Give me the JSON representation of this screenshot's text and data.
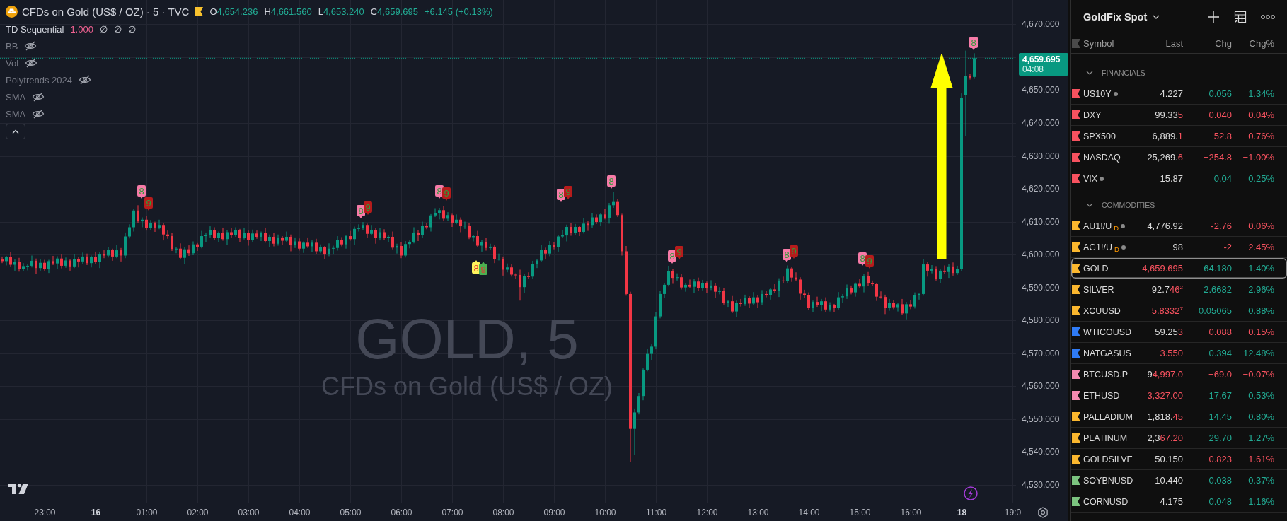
{
  "chart": {
    "header": {
      "title": "CFDs on Gold (US$ / OZ) · 5 · TVC",
      "ohlc": [
        {
          "label": "O",
          "value": "4,654.236"
        },
        {
          "label": "H",
          "value": "4,661.560"
        },
        {
          "label": "L",
          "value": "4,653.240"
        },
        {
          "label": "C",
          "value": "4,659.695"
        }
      ],
      "change": "+6.145 (+0.13%)",
      "negative": false
    },
    "indicators": [
      {
        "name": "TD Sequential",
        "hidden": false,
        "values": [
          {
            "text": "1.000",
            "color": "#f06292"
          },
          {
            "text": "∅"
          },
          {
            "text": "∅"
          },
          {
            "text": "∅"
          }
        ]
      },
      {
        "name": "BB",
        "hidden": true
      },
      {
        "name": "Vol",
        "hidden": true
      },
      {
        "name": "Polytrends 2024",
        "hidden": true
      },
      {
        "name": "SMA",
        "hidden": true
      },
      {
        "name": "SMA",
        "hidden": true
      }
    ],
    "watermark": {
      "symbol": "GOLD, 5",
      "description": "CFDs on Gold (US$ / OZ)"
    },
    "chart_data": {
      "type": "candlestick",
      "grid": true,
      "ylim": [
        4524.37,
        4677.39
      ],
      "categories": [
        null,
        null,
        null,
        null,
        null,
        null,
        null,
        null,
        null,
        null,
        "23:00",
        null,
        null,
        null,
        null,
        null,
        null,
        null,
        null,
        null,
        null,
        null,
        "16",
        null,
        null,
        null,
        null,
        null,
        null,
        null,
        null,
        null,
        null,
        null,
        "01:00",
        null,
        null,
        null,
        null,
        null,
        null,
        null,
        null,
        null,
        null,
        null,
        "02:00",
        null,
        null,
        null,
        null,
        null,
        null,
        null,
        null,
        null,
        null,
        null,
        "03:00",
        null,
        null,
        null,
        null,
        null,
        null,
        null,
        null,
        null,
        null,
        null,
        "04:00",
        null,
        null,
        null,
        null,
        null,
        null,
        null,
        null,
        null,
        null,
        null,
        "05:00",
        null,
        null,
        null,
        null,
        null,
        null,
        null,
        null,
        null,
        null,
        null,
        "06:00",
        null,
        null,
        null,
        null,
        null,
        null,
        null,
        null,
        null,
        null,
        null,
        "07:00",
        null,
        null,
        null,
        null,
        null,
        null,
        null,
        null,
        null,
        null,
        null,
        "08:00",
        null,
        null,
        null,
        null,
        null,
        null,
        null,
        null,
        null,
        null,
        null,
        "09:00",
        null,
        null,
        null,
        null,
        null,
        null,
        null,
        null,
        null,
        null,
        null,
        "10:00",
        null,
        null,
        null,
        null,
        null,
        null,
        null,
        null,
        null,
        null,
        null,
        "11:00",
        null,
        null,
        null,
        null,
        null,
        null,
        null,
        null,
        null,
        null,
        null,
        "12:00",
        null,
        null,
        null,
        null,
        null,
        null,
        null,
        null,
        null,
        null,
        null,
        "13:00",
        null,
        null,
        null,
        null,
        null,
        null,
        null,
        null,
        null,
        null,
        null,
        "14:00",
        null,
        null,
        null,
        null,
        null,
        null,
        null,
        null,
        null,
        null,
        null,
        "15:00",
        null,
        null,
        null,
        null,
        null,
        null,
        null,
        null,
        null,
        null,
        null,
        "16:00",
        null,
        null,
        null,
        null,
        null,
        null,
        null,
        null,
        null,
        null,
        null,
        "18",
        null,
        null,
        null,
        null,
        null,
        null,
        null,
        null,
        null,
        null,
        null,
        "19:0"
      ],
      "ohlc": [
        [
          4598.5,
          4599.4,
          4597.4,
          4598.0
        ],
        [
          4598.0,
          4599.6,
          4596.7,
          4599.2
        ],
        [
          4599.2,
          4600.8,
          4596.4,
          4596.9
        ],
        [
          4596.9,
          4598.5,
          4595.1,
          4597.8
        ],
        [
          4597.8,
          4599.0,
          4594.8,
          4595.6
        ],
        [
          4595.6,
          4597.4,
          4595.0,
          4596.5
        ],
        [
          4596.5,
          4597.0,
          4595.2,
          4596.6
        ],
        [
          4596.6,
          4599.7,
          4596.1,
          4598.1
        ],
        [
          4598.1,
          4598.8,
          4594.1,
          4595.9
        ],
        [
          4595.9,
          4598.7,
          4595.1,
          4597.5
        ],
        [
          4597.5,
          4598.4,
          4595.1,
          4595.7
        ],
        [
          4595.7,
          4598.4,
          4594.4,
          4598.0
        ],
        [
          4598.0,
          4599.6,
          4596.8,
          4597.3
        ],
        [
          4597.3,
          4599.5,
          4595.5,
          4598.8
        ],
        [
          4598.8,
          4600.0,
          4595.8,
          4596.6
        ],
        [
          4596.6,
          4599.1,
          4596.0,
          4598.2
        ],
        [
          4598.2,
          4598.6,
          4595.1,
          4596.4
        ],
        [
          4596.4,
          4600.2,
          4595.9,
          4598.6
        ],
        [
          4598.6,
          4599.3,
          4596.1,
          4597.9
        ],
        [
          4597.9,
          4600.6,
          4597.1,
          4599.4
        ],
        [
          4599.4,
          4600.3,
          4596.8,
          4597.4
        ],
        [
          4597.4,
          4599.7,
          4596.1,
          4599.3
        ],
        [
          4599.3,
          4600.9,
          4597.2,
          4597.7
        ],
        [
          4597.7,
          4600.8,
          4595.9,
          4600.1
        ],
        [
          4600.1,
          4601.3,
          4598.9,
          4599.7
        ],
        [
          4599.7,
          4602.3,
          4599.1,
          4601.4
        ],
        [
          4601.4,
          4601.8,
          4598.1,
          4599.4
        ],
        [
          4599.4,
          4602.9,
          4598.9,
          4601.3
        ],
        [
          4601.3,
          4602.0,
          4597.9,
          4599.7
        ],
        [
          4599.7,
          4606.7,
          4598.9,
          4605.5
        ],
        [
          4605.5,
          4609.2,
          4604.9,
          4608.3
        ],
        [
          4608.3,
          4613.8,
          4607.0,
          4613.4
        ],
        [
          4613.4,
          4615.0,
          4609.6,
          4610.1
        ],
        [
          4610.1,
          4611.3,
          4608.3,
          4610.6
        ],
        [
          4610.6,
          4611.8,
          4607.3,
          4608.1
        ],
        [
          4608.1,
          4610.5,
          4607.5,
          4609.6
        ],
        [
          4609.6,
          4610.0,
          4606.9,
          4608.2
        ],
        [
          4608.2,
          4610.6,
          4607.7,
          4609.0
        ],
        [
          4609.0,
          4609.7,
          4604.3,
          4606.1
        ],
        [
          4606.1,
          4607.3,
          4604.8,
          4605.6
        ],
        [
          4605.6,
          4606.5,
          4601.1,
          4601.7
        ],
        [
          4601.7,
          4602.2,
          4600.4,
          4601.8
        ],
        [
          4601.8,
          4603.4,
          4598.5,
          4599.0
        ],
        [
          4599.0,
          4602.3,
          4597.2,
          4601.6
        ],
        [
          4601.6,
          4602.8,
          4599.6,
          4600.4
        ],
        [
          4600.4,
          4604.0,
          4599.8,
          4603.1
        ],
        [
          4603.1,
          4603.5,
          4601.1,
          4602.4
        ],
        [
          4602.4,
          4607.2,
          4601.9,
          4605.6
        ],
        [
          4605.6,
          4606.7,
          4603.8,
          4606.0
        ],
        [
          4606.0,
          4608.6,
          4605.2,
          4607.4
        ],
        [
          4607.4,
          4608.3,
          4604.5,
          4605.1
        ],
        [
          4605.1,
          4607.0,
          4603.8,
          4606.6
        ],
        [
          4606.6,
          4608.2,
          4604.2,
          4604.7
        ],
        [
          4604.7,
          4607.5,
          4602.9,
          4606.8
        ],
        [
          4606.8,
          4608.0,
          4605.2,
          4606.0
        ],
        [
          4606.0,
          4608.3,
          4605.4,
          4607.4
        ],
        [
          4607.4,
          4607.8,
          4603.8,
          4605.1
        ],
        [
          4605.1,
          4608.2,
          4604.6,
          4606.6
        ],
        [
          4606.6,
          4607.3,
          4602.7,
          4604.5
        ],
        [
          4604.5,
          4607.6,
          4603.7,
          4606.4
        ],
        [
          4606.4,
          4607.3,
          4604.8,
          4605.4
        ],
        [
          4605.4,
          4607.0,
          4604.1,
          4606.6
        ],
        [
          4606.6,
          4608.2,
          4603.6,
          4604.1
        ],
        [
          4604.1,
          4606.1,
          4602.3,
          4605.4
        ],
        [
          4605.4,
          4606.6,
          4602.5,
          4603.3
        ],
        [
          4603.3,
          4606.1,
          4602.7,
          4605.2
        ],
        [
          4605.2,
          4605.6,
          4602.9,
          4604.2
        ],
        [
          4604.2,
          4607.0,
          4603.7,
          4605.4
        ],
        [
          4605.4,
          4606.1,
          4601.0,
          4602.8
        ],
        [
          4602.8,
          4605.2,
          4602.0,
          4604.0
        ],
        [
          4604.0,
          4604.9,
          4601.2,
          4601.8
        ],
        [
          4601.8,
          4604.0,
          4600.5,
          4603.6
        ],
        [
          4603.6,
          4605.2,
          4602.0,
          4602.5
        ],
        [
          4602.5,
          4604.3,
          4600.7,
          4603.6
        ],
        [
          4603.6,
          4604.8,
          4600.2,
          4601.0
        ],
        [
          4601.0,
          4603.1,
          4600.4,
          4602.2
        ],
        [
          4602.2,
          4602.6,
          4598.7,
          4600.0
        ],
        [
          4600.0,
          4603.4,
          4599.5,
          4601.8
        ],
        [
          4601.8,
          4602.7,
          4600.0,
          4602.0
        ],
        [
          4602.0,
          4605.6,
          4601.2,
          4604.4
        ],
        [
          4604.4,
          4605.3,
          4602.5,
          4603.1
        ],
        [
          4603.1,
          4606.0,
          4601.8,
          4605.6
        ],
        [
          4605.6,
          4607.2,
          4604.2,
          4604.7
        ],
        [
          4604.7,
          4608.5,
          4602.9,
          4607.8
        ],
        [
          4607.8,
          4609.2,
          4607.0,
          4608.0
        ],
        [
          4608.0,
          4609.9,
          4607.4,
          4609.0
        ],
        [
          4609.0,
          4609.4,
          4605.0,
          4606.3
        ],
        [
          4606.3,
          4609.0,
          4605.8,
          4607.4
        ],
        [
          4607.4,
          4608.1,
          4603.3,
          4605.1
        ],
        [
          4605.1,
          4608.0,
          4604.3,
          4606.8
        ],
        [
          4606.8,
          4607.7,
          4604.4,
          4605.0
        ],
        [
          4605.0,
          4605.8,
          4603.7,
          4605.4
        ],
        [
          4605.4,
          4607.0,
          4601.6,
          4602.1
        ],
        [
          4602.1,
          4603.3,
          4600.3,
          4602.6
        ],
        [
          4602.6,
          4603.8,
          4598.9,
          4599.7
        ],
        [
          4599.7,
          4604.1,
          4599.1,
          4603.2
        ],
        [
          4603.2,
          4604.3,
          4601.9,
          4603.9
        ],
        [
          4603.9,
          4608.3,
          4603.4,
          4606.7
        ],
        [
          4606.7,
          4607.4,
          4604.1,
          4605.9
        ],
        [
          4605.9,
          4610.0,
          4605.1,
          4608.8
        ],
        [
          4608.8,
          4609.7,
          4607.7,
          4608.3
        ],
        [
          4608.3,
          4612.3,
          4607.0,
          4611.9
        ],
        [
          4611.9,
          4614.1,
          4611.4,
          4612.5
        ],
        [
          4612.5,
          4614.2,
          4610.7,
          4613.5
        ],
        [
          4613.5,
          4614.7,
          4610.1,
          4610.9
        ],
        [
          4610.9,
          4612.9,
          4610.3,
          4612.0
        ],
        [
          4612.0,
          4612.4,
          4608.4,
          4609.7
        ],
        [
          4609.7,
          4612.2,
          4609.2,
          4610.6
        ],
        [
          4610.6,
          4611.3,
          4606.8,
          4608.6
        ],
        [
          4608.6,
          4610.0,
          4607.8,
          4608.8
        ],
        [
          4608.8,
          4609.7,
          4604.7,
          4605.3
        ],
        [
          4605.3,
          4606.0,
          4604.0,
          4605.6
        ],
        [
          4605.6,
          4607.2,
          4602.2,
          4602.7
        ],
        [
          4602.7,
          4604.5,
          4600.9,
          4603.8
        ],
        [
          4603.8,
          4605.0,
          4601.2,
          4602.0
        ],
        [
          4602.0,
          4603.3,
          4601.4,
          4602.4
        ],
        [
          4602.4,
          4602.8,
          4597.4,
          4598.7
        ],
        [
          4598.7,
          4600.3,
          4598.2,
          4598.7
        ],
        [
          4598.7,
          4599.4,
          4593.6,
          4595.4
        ],
        [
          4595.4,
          4597.3,
          4594.6,
          4596.1
        ],
        [
          4596.1,
          4597.0,
          4593.3,
          4593.9
        ],
        [
          4593.9,
          4594.3,
          4592.5,
          4593.8
        ],
        [
          4593.8,
          4595.4,
          4586.0,
          4590.1
        ],
        [
          4590.1,
          4594.1,
          4588.3,
          4593.4
        ],
        [
          4593.4,
          4594.6,
          4592.5,
          4593.3
        ],
        [
          4593.3,
          4598.1,
          4592.7,
          4597.2
        ],
        [
          4597.2,
          4598.6,
          4595.9,
          4598.2
        ],
        [
          4598.2,
          4603.0,
          4597.7,
          4601.4
        ],
        [
          4601.4,
          4602.1,
          4598.5,
          4600.3
        ],
        [
          4600.3,
          4604.1,
          4599.5,
          4602.9
        ],
        [
          4602.9,
          4603.8,
          4601.6,
          4602.2
        ],
        [
          4602.2,
          4605.9,
          4600.9,
          4605.5
        ],
        [
          4605.5,
          4607.4,
          4605.0,
          4605.8
        ],
        [
          4605.8,
          4609.1,
          4604.0,
          4608.4
        ],
        [
          4608.4,
          4609.6,
          4605.7,
          4606.5
        ],
        [
          4606.5,
          4609.3,
          4605.9,
          4608.4
        ],
        [
          4608.4,
          4608.8,
          4605.6,
          4606.9
        ],
        [
          4606.9,
          4611.0,
          4606.4,
          4609.4
        ],
        [
          4609.4,
          4610.1,
          4607.2,
          4609.0
        ],
        [
          4609.0,
          4612.5,
          4608.2,
          4611.3
        ],
        [
          4611.3,
          4612.2,
          4609.3,
          4609.9
        ],
        [
          4609.9,
          4612.6,
          4608.6,
          4612.2
        ],
        [
          4612.2,
          4613.8,
          4610.7,
          4611.2
        ],
        [
          4611.2,
          4615.7,
          4609.4,
          4615.0
        ],
        [
          4615.0,
          4619.0,
          4614.2,
          4616.0
        ],
        [
          4616.0,
          4616.9,
          4611.4,
          4612.0
        ],
        [
          4612.0,
          4612.4,
          4599.7,
          4601.0
        ],
        [
          4601.0,
          4602.6,
          4587.5,
          4588.0
        ],
        [
          4588.0,
          4588.7,
          4537.0,
          4547.0
        ],
        [
          4547.0,
          4553.2,
          4539.0,
          4552.0
        ],
        [
          4552.0,
          4557.9,
          4551.4,
          4557.0
        ],
        [
          4557.0,
          4565.4,
          4555.7,
          4565.0
        ],
        [
          4565.0,
          4571.4,
          4564.5,
          4569.8
        ],
        [
          4569.8,
          4572.7,
          4568.0,
          4572.0
        ],
        [
          4572.0,
          4582.4,
          4571.2,
          4581.2
        ],
        [
          4581.2,
          4588.9,
          4580.6,
          4588.0
        ],
        [
          4588.0,
          4591.2,
          4586.7,
          4590.8
        ],
        [
          4590.8,
          4596.6,
          4590.3,
          4595.0
        ],
        [
          4595.0,
          4595.7,
          4591.1,
          4592.9
        ],
        [
          4592.9,
          4594.3,
          4592.1,
          4593.1
        ],
        [
          4593.1,
          4594.0,
          4589.4,
          4590.0
        ],
        [
          4590.0,
          4591.2,
          4588.7,
          4590.8
        ],
        [
          4590.8,
          4592.4,
          4589.7,
          4590.2
        ],
        [
          4590.2,
          4592.5,
          4588.4,
          4591.8
        ],
        [
          4591.8,
          4593.0,
          4588.9,
          4589.7
        ],
        [
          4589.7,
          4592.3,
          4589.1,
          4591.4
        ],
        [
          4591.4,
          4591.8,
          4588.4,
          4589.7
        ],
        [
          4589.7,
          4592.2,
          4589.2,
          4590.6
        ],
        [
          4590.6,
          4591.3,
          4586.9,
          4588.7
        ],
        [
          4588.7,
          4590.1,
          4587.9,
          4588.9
        ],
        [
          4588.9,
          4589.8,
          4584.8,
          4585.4
        ],
        [
          4585.4,
          4586.2,
          4584.1,
          4585.8
        ],
        [
          4585.8,
          4587.4,
          4582.2,
          4582.7
        ],
        [
          4582.7,
          4586.0,
          4580.9,
          4585.3
        ],
        [
          4585.3,
          4586.5,
          4584.2,
          4585.0
        ],
        [
          4585.0,
          4587.8,
          4584.4,
          4586.9
        ],
        [
          4586.9,
          4587.3,
          4583.8,
          4585.1
        ],
        [
          4585.1,
          4588.6,
          4584.6,
          4587.0
        ],
        [
          4587.0,
          4587.7,
          4583.7,
          4585.5
        ],
        [
          4585.5,
          4589.2,
          4584.7,
          4588.0
        ],
        [
          4588.0,
          4588.9,
          4587.0,
          4587.6
        ],
        [
          4587.6,
          4589.8,
          4586.3,
          4589.4
        ],
        [
          4589.4,
          4591.0,
          4588.4,
          4588.9
        ],
        [
          4588.9,
          4592.8,
          4587.1,
          4592.1
        ],
        [
          4592.1,
          4593.3,
          4591.2,
          4592.0
        ],
        [
          4592.0,
          4596.7,
          4591.4,
          4595.8
        ],
        [
          4595.8,
          4596.2,
          4591.7,
          4593.0
        ],
        [
          4593.0,
          4594.6,
          4591.9,
          4592.4
        ],
        [
          4592.4,
          4593.1,
          4586.3,
          4588.1
        ],
        [
          4588.1,
          4589.3,
          4586.8,
          4587.6
        ],
        [
          4587.6,
          4588.5,
          4583.1,
          4583.7
        ],
        [
          4583.7,
          4586.0,
          4582.4,
          4585.6
        ],
        [
          4585.6,
          4587.2,
          4584.1,
          4584.6
        ],
        [
          4584.6,
          4586.5,
          4582.8,
          4585.8
        ],
        [
          4585.8,
          4587.0,
          4582.5,
          4583.3
        ],
        [
          4583.3,
          4585.5,
          4582.7,
          4584.6
        ],
        [
          4584.6,
          4585.0,
          4582.5,
          4583.8
        ],
        [
          4583.8,
          4588.6,
          4583.3,
          4587.0
        ],
        [
          4587.0,
          4588.0,
          4585.2,
          4587.3
        ],
        [
          4587.3,
          4590.9,
          4586.5,
          4589.7
        ],
        [
          4589.7,
          4590.6,
          4587.9,
          4588.5
        ],
        [
          4588.5,
          4591.5,
          4587.2,
          4591.1
        ],
        [
          4591.1,
          4592.7,
          4589.8,
          4590.3
        ],
        [
          4590.3,
          4594.2,
          4588.5,
          4593.5
        ],
        [
          4593.5,
          4594.7,
          4590.4,
          4591.2
        ],
        [
          4591.2,
          4592.1,
          4590.4,
          4591.0
        ],
        [
          4591.0,
          4591.4,
          4585.9,
          4587.2
        ],
        [
          4587.2,
          4588.8,
          4586.6,
          4587.1
        ],
        [
          4587.1,
          4587.8,
          4581.9,
          4583.7
        ],
        [
          4583.7,
          4586.5,
          4582.9,
          4585.3
        ],
        [
          4585.3,
          4586.2,
          4583.4,
          4584.0
        ],
        [
          4584.0,
          4585.3,
          4582.7,
          4584.9
        ],
        [
          4584.9,
          4586.5,
          4581.6,
          4582.1
        ],
        [
          4582.1,
          4585.6,
          4580.3,
          4584.9
        ],
        [
          4584.9,
          4586.1,
          4583.4,
          4584.2
        ],
        [
          4584.2,
          4588.5,
          4583.6,
          4587.6
        ],
        [
          4587.6,
          4588.4,
          4586.3,
          4588.0
        ],
        [
          4588.0,
          4598.6,
          4587.5,
          4597.0
        ],
        [
          4597.0,
          4597.7,
          4593.3,
          4595.1
        ],
        [
          4595.1,
          4596.8,
          4594.3,
          4595.6
        ],
        [
          4595.6,
          4596.5,
          4592.1,
          4592.7
        ],
        [
          4592.7,
          4595.5,
          4591.4,
          4595.1
        ],
        [
          4595.1,
          4596.7,
          4594.2,
          4594.7
        ],
        [
          4594.7,
          4597.1,
          4592.9,
          4596.4
        ],
        [
          4596.4,
          4597.6,
          4593.6,
          4594.4
        ],
        [
          4594.4,
          4596.6,
          4593.8,
          4595.7
        ],
        [
          4595.7,
          4649.0,
          4595.0,
          4647.7
        ],
        [
          4648.4,
          4662.0,
          4636.0,
          4654.3
        ],
        [
          4654.3,
          4655.0,
          4653.2,
          4653.8
        ],
        [
          4654.0,
          4661.2,
          4653.4,
          4659.7
        ],
        null,
        null,
        null,
        null,
        null,
        null,
        null,
        null,
        null
      ],
      "yticks": [
        {
          "value": 4670,
          "label": "4,670.000"
        },
        {
          "value": 4650,
          "label": "4,650.000"
        },
        {
          "value": 4640,
          "label": "4,640.000"
        },
        {
          "value": 4630,
          "label": "4,630.000"
        },
        {
          "value": 4620,
          "label": "4,620.000"
        },
        {
          "value": 4610,
          "label": "4,610.000"
        },
        {
          "value": 4600,
          "label": "4,600.000"
        },
        {
          "value": 4590,
          "label": "4,590.000"
        },
        {
          "value": 4580,
          "label": "4,580.000"
        },
        {
          "value": 4570,
          "label": "4,570.000"
        },
        {
          "value": 4560,
          "label": "4,560.000"
        },
        {
          "value": 4550,
          "label": "4,550.000"
        },
        {
          "value": 4540,
          "label": "4,540.000"
        },
        {
          "value": 4530,
          "label": "4,530.000"
        }
      ],
      "ref_lines": [
        {
          "axis": "y",
          "value": 4659.695,
          "label": "4,659.695"
        }
      ]
    },
    "time_axis": [
      {
        "kind": "time"
      },
      {
        "kind": "day"
      },
      {
        "kind": "time"
      },
      {
        "kind": "time"
      },
      {
        "kind": "time"
      },
      {
        "kind": "time"
      },
      {
        "kind": "time"
      },
      {
        "kind": "time"
      },
      {
        "kind": "time"
      },
      {
        "kind": "time"
      },
      {
        "kind": "time"
      },
      {
        "kind": "time"
      },
      {
        "kind": "time"
      },
      {
        "kind": "time"
      },
      {
        "kind": "time"
      },
      {
        "kind": "time"
      },
      {
        "kind": "time"
      },
      {
        "kind": "time"
      },
      {
        "kind": "day"
      },
      {
        "kind": "time"
      }
    ],
    "markers": [
      {
        "text": "8",
        "kind": "sell",
        "color": "#f77ba8"
      },
      {
        "text": "9",
        "kind": "sell",
        "color": "#b71c1c"
      },
      {
        "text": "8",
        "kind": "sell",
        "color": "#f77ba8"
      },
      {
        "text": "9",
        "kind": "sell",
        "color": "#b71c1c"
      },
      {
        "text": "8",
        "kind": "sell",
        "color": "#f77ba8"
      },
      {
        "text": "9",
        "kind": "sell",
        "color": "#b71c1c"
      },
      {
        "text": "8",
        "kind": "buy",
        "color": "#fff35c"
      },
      {
        "text": "9",
        "kind": "buy",
        "color": "#4caf50"
      },
      {
        "text": "8",
        "kind": "sell",
        "color": "#f77ba8"
      },
      {
        "text": "9",
        "kind": "sell",
        "color": "#b71c1c"
      },
      {
        "text": "8",
        "kind": "sell",
        "color": "#f77ba8"
      },
      {
        "text": "8",
        "kind": "sell",
        "color": "#f77ba8"
      },
      {
        "text": "9",
        "kind": "sell",
        "color": "#b71c1c"
      },
      {
        "text": "8",
        "kind": "sell",
        "color": "#f77ba8"
      },
      {
        "text": "9",
        "kind": "sell",
        "color": "#b71c1c"
      },
      {
        "text": "8",
        "kind": "sell",
        "color": "#f77ba8"
      },
      {
        "text": "9",
        "kind": "sell",
        "color": "#b71c1c"
      },
      {
        "text": "8",
        "kind": "sell",
        "color": "#f77ba8"
      }
    ],
    "price_tag": {
      "countdown": "04:08"
    }
  },
  "watchlist": {
    "title": "GoldFix Spot",
    "columns": [
      "Symbol",
      "Last",
      "Chg",
      "Chg%"
    ],
    "groups": [
      {
        "name": "FINANCIALS",
        "expanded": true,
        "children": [
          {
            "symbol": "US10Y",
            "color": "#f7525f",
            "status_dot": true,
            "selected": false,
            "last": [
              {
                "text": "4.227",
                "changed": false
              }
            ],
            "chg": "0.056",
            "chg_pct": "1.34%",
            "negative": false
          },
          {
            "symbol": "DXY",
            "color": "#f7525f",
            "status_dot": false,
            "selected": false,
            "last": [
              {
                "text": "99.33",
                "changed": false
              },
              {
                "text": "5",
                "changed": true
              }
            ],
            "chg": "−0.040",
            "chg_pct": "−0.04%",
            "negative": true
          },
          {
            "symbol": "SPX500",
            "color": "#f7525f",
            "status_dot": false,
            "selected": false,
            "last": [
              {
                "text": "6,889.",
                "changed": false
              },
              {
                "text": "1",
                "changed": true
              }
            ],
            "chg": "−52.8",
            "chg_pct": "−0.76%",
            "negative": true
          },
          {
            "symbol": "NASDAQ",
            "color": "#f7525f",
            "status_dot": false,
            "selected": false,
            "last": [
              {
                "text": "25,269.",
                "changed": false
              },
              {
                "text": "6",
                "changed": true
              }
            ],
            "chg": "−254.8",
            "chg_pct": "−1.00%",
            "negative": true
          },
          {
            "symbol": "VIX",
            "color": "#f7525f",
            "status_dot": true,
            "selected": false,
            "last": [
              {
                "text": "15.87",
                "changed": false
              }
            ],
            "chg": "0.04",
            "chg_pct": "0.25%",
            "negative": false
          }
        ]
      },
      {
        "name": "COMMODITIES",
        "expanded": true,
        "children": [
          {
            "symbol": "AU1!/U",
            "badge": "D",
            "color": "#fbb72e",
            "status_dot": true,
            "selected": false,
            "last": [
              {
                "text": "4,776.92",
                "changed": false
              }
            ],
            "chg": "-2.76",
            "chg_pct": "−0.06%",
            "negative": true
          },
          {
            "symbol": "AG1!/U",
            "badge": "D",
            "color": "#fbb72e",
            "status_dot": true,
            "selected": false,
            "last": [
              {
                "text": "98",
                "changed": false
              }
            ],
            "chg": "-2",
            "chg_pct": "−2.45%",
            "negative": true
          },
          {
            "symbol": "GOLD",
            "color": "#fbb72e",
            "status_dot": false,
            "selected": true,
            "last": [
              {
                "text": "4,659.695",
                "changed": true
              }
            ],
            "chg": "64.180",
            "chg_pct": "1.40%",
            "negative": false
          },
          {
            "symbol": "SILVER",
            "color": "#fbb72e",
            "status_dot": false,
            "selected": false,
            "last": [
              {
                "text": "92.7",
                "changed": false
              },
              {
                "text": "46$^{2}$",
                "changed": true
              }
            ],
            "chg": "2.6682",
            "chg_pct": "2.96%",
            "negative": false
          },
          {
            "symbol": "XCUUSD",
            "color": "#fbb72e",
            "status_dot": false,
            "selected": false,
            "last": [
              {
                "text": "5.8332$^{7}$",
                "changed": true
              }
            ],
            "chg": "0.05065",
            "chg_pct": "0.88%",
            "negative": false
          },
          {
            "symbol": "WTICOUSD",
            "color": "#2f7bf5",
            "status_dot": false,
            "selected": false,
            "last": [
              {
                "text": "59.25",
                "changed": false
              },
              {
                "text": "3",
                "changed": true
              }
            ],
            "chg": "−0.088",
            "chg_pct": "−0.15%",
            "negative": true
          },
          {
            "symbol": "NATGASUS",
            "color": "#2f7bf5",
            "status_dot": false,
            "selected": false,
            "last": [
              {
                "text": "3.550",
                "changed": true
              }
            ],
            "chg": "0.394",
            "chg_pct": "12.48%",
            "negative": false
          },
          {
            "symbol": "BTCUSD.P",
            "color": "#f38ab0",
            "status_dot": false,
            "selected": false,
            "last": [
              {
                "text": "9",
                "changed": false
              },
              {
                "text": "4,997.0",
                "changed": true
              }
            ],
            "chg": "−69.0",
            "chg_pct": "−0.07%",
            "negative": true
          },
          {
            "symbol": "ETHUSD",
            "color": "#f38ab0",
            "status_dot": false,
            "selected": false,
            "last": [
              {
                "text": "3,327.00",
                "changed": true
              }
            ],
            "chg": "17.67",
            "chg_pct": "0.53%",
            "negative": false
          },
          {
            "symbol": "PALLADIUM",
            "color": "#fbb72e",
            "status_dot": false,
            "selected": false,
            "last": [
              {
                "text": "1,818.",
                "changed": false
              },
              {
                "text": "45",
                "changed": true
              }
            ],
            "chg": "14.45",
            "chg_pct": "0.80%",
            "negative": false
          },
          {
            "symbol": "PLATINUM",
            "color": "#fbb72e",
            "status_dot": false,
            "selected": false,
            "last": [
              {
                "text": "2,3",
                "changed": false
              },
              {
                "text": "67.20",
                "changed": true
              }
            ],
            "chg": "29.70",
            "chg_pct": "1.27%",
            "negative": false
          },
          {
            "symbol": "GOLDSILVE",
            "color": "#fbb72e",
            "status_dot": false,
            "selected": false,
            "last": [
              {
                "text": "50.150",
                "changed": false
              }
            ],
            "chg": "−0.823",
            "chg_pct": "−1.61%",
            "negative": true
          },
          {
            "symbol": "SOYBNUSD",
            "color": "#7cc47f",
            "status_dot": false,
            "selected": false,
            "last": [
              {
                "text": "10.440",
                "changed": false
              }
            ],
            "chg": "0.038",
            "chg_pct": "0.37%",
            "negative": false
          },
          {
            "symbol": "CORNUSD",
            "color": "#7cc47f",
            "status_dot": false,
            "selected": false,
            "last": [
              {
                "text": "4.175",
                "changed": false
              }
            ],
            "chg": "0.048",
            "chg_pct": "1.16%",
            "negative": false
          }
        ]
      }
    ]
  }
}
